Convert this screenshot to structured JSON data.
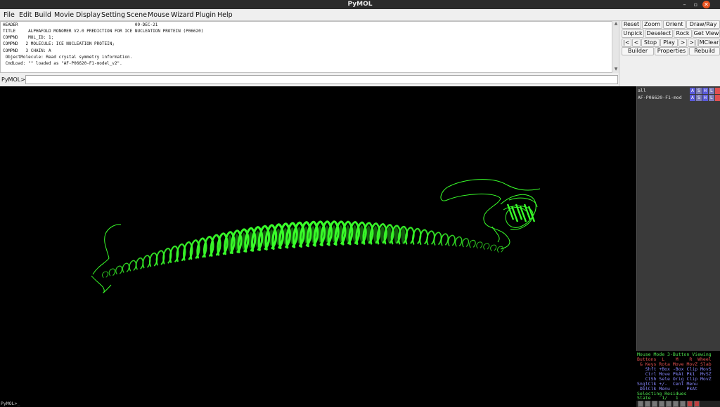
{
  "window": {
    "title": "PyMOL",
    "minimize": "–",
    "maximize": "▫",
    "close": "✕"
  },
  "menu": [
    "File",
    "Edit",
    "Build",
    "Movie",
    "Display",
    "Setting",
    "Scene",
    "Mouse",
    "Wizard",
    "Plugin",
    "Help"
  ],
  "log": [
    "HEADER                                              09-DEC-21",
    "TITLE     ALPHAFOLD MONOMER V2.0 PREDICTION FOR ICE NUCLEATION PROTEIN (P06620)",
    "COMPND    MOL_ID: 1;",
    "COMPND   2 MOLECULE: ICE NUCLEATION PROTEIN;",
    "COMPND   3 CHAIN: A",
    " ObjectMolecule: Read crystal symmetry information.",
    " CmdLoad: \"\" loaded as \"AF-P06620-F1-model_v2\"."
  ],
  "command": {
    "prompt": "PyMOL>",
    "value": ""
  },
  "buttons": {
    "reset": "Reset",
    "zoom": "Zoom",
    "orient": "Orient",
    "draw_ray": "Draw/Ray",
    "unpick": "Unpick",
    "deselect": "Deselect",
    "rock": "Rock",
    "get_view": "Get View",
    "first": "|<",
    "prev": "<",
    "stop": "Stop",
    "play": "Play",
    "next": ">",
    "last": ">|",
    "mclear": "MClear",
    "builder": "Builder",
    "properties": "Properties",
    "rebuild": "Rebuild"
  },
  "objects": [
    {
      "name": "all",
      "btns": [
        "A",
        "S",
        "H",
        "L"
      ]
    },
    {
      "name": "AF-P06620-F1-mod",
      "btns": [
        "A",
        "S",
        "H",
        "L"
      ]
    }
  ],
  "mouse_mode": {
    "header": "Mouse Mode 3-Button Viewing",
    "buttons_row": "Buttons  L    M    R  Wheel",
    "keys_row": " & Keys Rota Move MovZ Slab",
    "shft_row": "   Shft +Box -Box Clip MovS",
    "ctrl_row": "   Ctrl Move PkAt Pk1  MvSZ",
    "ctsh_row": "   CtSh Sele Orig Clip MovZ",
    "snglclk_row": "SnglClk +/-  Cent Menu",
    "dblclk_row": " DblClk Menu  -   PkAt",
    "selecting": "Selecting Residues",
    "state": "State    1/   1"
  },
  "console": "PyMOL>_",
  "colors": {
    "protein": "#39ff2a",
    "panel_bg": "#3a3a3a",
    "obj_a": "#6a6aff",
    "obj_s": "#8888c8",
    "obj_h": "#6a6aff",
    "obj_l": "#8888c8",
    "obj_c": "#e05050"
  }
}
